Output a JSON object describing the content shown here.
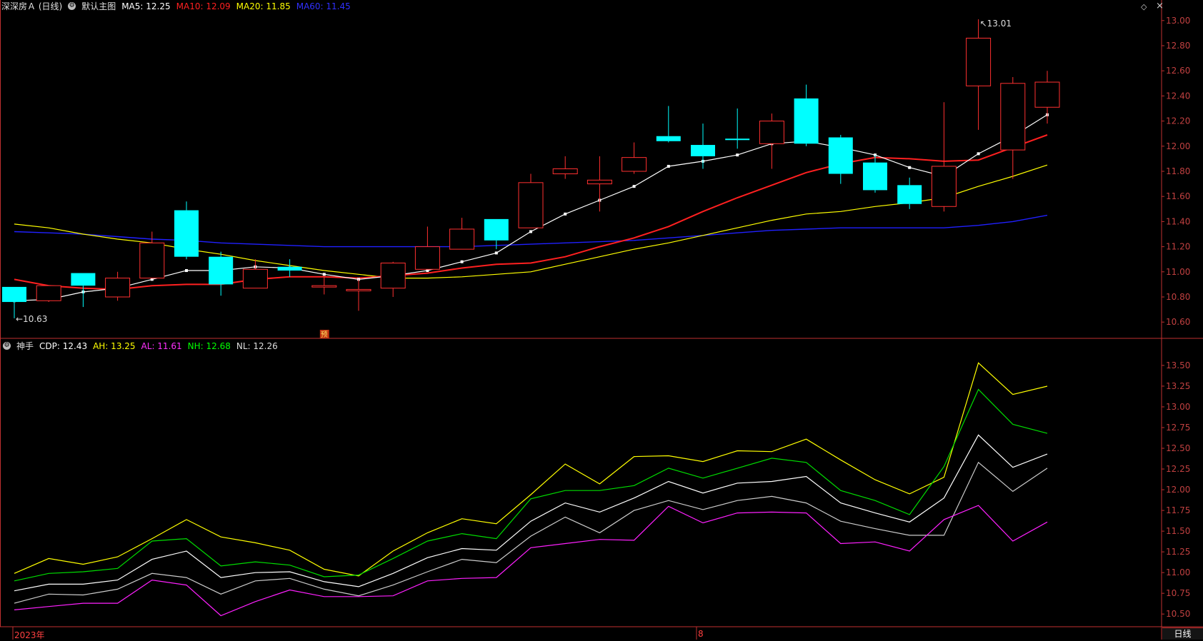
{
  "header": {
    "title": "深深房Ａ (日线)",
    "main_label": "默认主图",
    "ma_readouts": [
      {
        "label": "MA5: 12.25",
        "color": "#ffffff"
      },
      {
        "label": "MA10: 12.09",
        "color": "#ff2020"
      },
      {
        "label": "MA20: 11.85",
        "color": "#ffff00"
      },
      {
        "label": "MA60: 11.45",
        "color": "#3030ff"
      }
    ]
  },
  "indicator_header": {
    "name": "神手",
    "readouts": [
      {
        "label": "CDP: 12.43",
        "color": "#ffffff"
      },
      {
        "label": "AH: 13.25",
        "color": "#ffff00"
      },
      {
        "label": "AL: 11.61",
        "color": "#ff30ff"
      },
      {
        "label": "NH: 12.68",
        "color": "#00ff00"
      },
      {
        "label": "NL: 12.26",
        "color": "#dddddd"
      }
    ]
  },
  "footer": {
    "year_label": "2023年",
    "month_label": "8",
    "period_button": "日线"
  },
  "marker_label": "预",
  "colors": {
    "up": "#ff3030",
    "down": "#00ffff",
    "axis": "#c03030",
    "ma5": "#ffffff",
    "ma10": "#ff2020",
    "ma20": "#ffff00",
    "ma60": "#2020ff"
  },
  "chart_data": [
    {
      "type": "candlestick",
      "y_ticks": [
        10.6,
        10.8,
        11.0,
        11.2,
        11.4,
        11.6,
        11.8,
        12.0,
        12.2,
        12.4,
        12.6,
        12.8,
        13.0
      ],
      "ylim": [
        10.55,
        13.05
      ],
      "candles": [
        {
          "o": 10.88,
          "h": 10.88,
          "l": 10.63,
          "c": 10.76
        },
        {
          "o": 10.77,
          "h": 10.89,
          "l": 10.76,
          "c": 10.89
        },
        {
          "o": 10.99,
          "h": 10.99,
          "l": 10.72,
          "c": 10.89
        },
        {
          "o": 10.8,
          "h": 11.0,
          "l": 10.77,
          "c": 10.95
        },
        {
          "o": 10.95,
          "h": 11.32,
          "l": 10.95,
          "c": 11.23
        },
        {
          "o": 11.49,
          "h": 11.56,
          "l": 11.1,
          "c": 11.12
        },
        {
          "o": 11.12,
          "h": 11.16,
          "l": 10.81,
          "c": 10.9
        },
        {
          "o": 10.87,
          "h": 11.1,
          "l": 10.87,
          "c": 11.02
        },
        {
          "o": 11.04,
          "h": 11.1,
          "l": 10.96,
          "c": 11.01
        },
        {
          "o": 10.89,
          "h": 10.96,
          "l": 10.82,
          "c": 10.89
        },
        {
          "o": 10.85,
          "h": 10.94,
          "l": 10.69,
          "c": 10.86
        },
        {
          "o": 10.87,
          "h": 11.08,
          "l": 10.8,
          "c": 11.07
        },
        {
          "o": 11.02,
          "h": 11.36,
          "l": 11.02,
          "c": 11.2
        },
        {
          "o": 11.18,
          "h": 11.43,
          "l": 11.18,
          "c": 11.34
        },
        {
          "o": 11.42,
          "h": 11.42,
          "l": 11.18,
          "c": 11.25
        },
        {
          "o": 11.35,
          "h": 11.78,
          "l": 11.35,
          "c": 11.71
        },
        {
          "o": 11.78,
          "h": 11.92,
          "l": 11.74,
          "c": 11.82
        },
        {
          "o": 11.7,
          "h": 11.92,
          "l": 11.48,
          "c": 11.73
        },
        {
          "o": 11.8,
          "h": 12.03,
          "l": 11.78,
          "c": 11.91
        },
        {
          "o": 12.08,
          "h": 12.32,
          "l": 12.03,
          "c": 12.04
        },
        {
          "o": 12.01,
          "h": 12.18,
          "l": 11.82,
          "c": 11.92
        },
        {
          "o": 12.06,
          "h": 12.3,
          "l": 11.98,
          "c": 12.05
        },
        {
          "o": 12.02,
          "h": 12.26,
          "l": 11.82,
          "c": 12.2
        },
        {
          "o": 12.38,
          "h": 12.49,
          "l": 12.0,
          "c": 12.02
        },
        {
          "o": 12.07,
          "h": 12.09,
          "l": 11.7,
          "c": 11.78
        },
        {
          "o": 11.87,
          "h": 11.93,
          "l": 11.63,
          "c": 11.65
        },
        {
          "o": 11.69,
          "h": 11.75,
          "l": 11.5,
          "c": 11.54
        },
        {
          "o": 11.52,
          "h": 12.35,
          "l": 11.48,
          "c": 11.84
        },
        {
          "o": 12.48,
          "h": 13.01,
          "l": 12.13,
          "c": 12.86
        },
        {
          "o": 11.97,
          "h": 12.55,
          "l": 11.74,
          "c": 12.5
        },
        {
          "o": 12.31,
          "h": 12.6,
          "l": 12.18,
          "c": 12.51
        }
      ],
      "ma5": [
        10.77,
        10.78,
        10.84,
        10.87,
        10.94,
        11.01,
        11.01,
        11.04,
        11.03,
        10.98,
        10.94,
        10.97,
        11.01,
        11.08,
        11.15,
        11.32,
        11.46,
        11.57,
        11.68,
        11.84,
        11.88,
        11.93,
        12.02,
        12.04,
        11.99,
        11.93,
        11.83,
        11.76,
        11.94,
        12.08,
        12.25
      ],
      "ma10": [
        10.94,
        10.89,
        10.87,
        10.86,
        10.89,
        10.9,
        10.9,
        10.94,
        10.96,
        10.96,
        10.95,
        10.97,
        10.99,
        11.03,
        11.06,
        11.07,
        11.12,
        11.2,
        11.27,
        11.36,
        11.48,
        11.59,
        11.69,
        11.79,
        11.86,
        11.91,
        11.9,
        11.88,
        11.89,
        11.99,
        12.09
      ],
      "ma20": [
        11.38,
        11.35,
        11.3,
        11.26,
        11.23,
        11.18,
        11.14,
        11.09,
        11.05,
        11.01,
        10.98,
        10.95,
        10.95,
        10.96,
        10.98,
        11.0,
        11.06,
        11.12,
        11.18,
        11.23,
        11.29,
        11.35,
        11.41,
        11.46,
        11.48,
        11.52,
        11.55,
        11.59,
        11.68,
        11.76,
        11.85
      ],
      "ma60": [
        11.32,
        11.31,
        11.3,
        11.28,
        11.26,
        11.25,
        11.23,
        11.22,
        11.21,
        11.2,
        11.2,
        11.2,
        11.2,
        11.2,
        11.21,
        11.22,
        11.23,
        11.24,
        11.25,
        11.27,
        11.29,
        11.31,
        11.33,
        11.34,
        11.35,
        11.35,
        11.35,
        11.35,
        11.37,
        11.4,
        11.45
      ],
      "annotations": [
        {
          "text": "10.63"
        },
        {
          "text": "13.01"
        }
      ]
    },
    {
      "type": "line",
      "title": "神手",
      "y_ticks": [
        10.5,
        10.75,
        11.0,
        11.25,
        11.5,
        11.75,
        12.0,
        12.25,
        12.5,
        12.75,
        13.0,
        13.25,
        13.5
      ],
      "ylim": [
        10.45,
        13.62
      ],
      "series": [
        {
          "name": "AH",
          "values": [
            10.99,
            11.17,
            11.1,
            11.19,
            11.41,
            11.64,
            11.43,
            11.36,
            11.27,
            11.04,
            10.96,
            11.26,
            11.48,
            11.65,
            11.59,
            11.94,
            12.31,
            12.07,
            12.4,
            12.41,
            12.34,
            12.47,
            12.46,
            12.61,
            12.36,
            12.12,
            11.95,
            12.15,
            13.53,
            13.15,
            13.25
          ]
        },
        {
          "name": "NH",
          "values": [
            10.9,
            10.99,
            11.01,
            11.05,
            11.38,
            11.41,
            11.08,
            11.13,
            11.09,
            10.95,
            10.97,
            11.17,
            11.38,
            11.47,
            11.41,
            11.89,
            11.99,
            11.99,
            12.05,
            12.26,
            12.14,
            12.26,
            12.38,
            12.33,
            11.99,
            11.87,
            11.7,
            12.28,
            13.21,
            12.79,
            12.68
          ]
        },
        {
          "name": "CDP",
          "values": [
            10.78,
            10.86,
            10.86,
            10.91,
            11.16,
            11.26,
            10.94,
            11.0,
            11.01,
            10.89,
            10.83,
            10.99,
            11.18,
            11.29,
            11.27,
            11.62,
            11.84,
            11.73,
            11.9,
            12.1,
            11.96,
            12.08,
            12.1,
            12.16,
            11.84,
            11.72,
            11.61,
            11.9,
            12.66,
            12.27,
            12.43
          ]
        },
        {
          "name": "NL",
          "values": [
            10.63,
            10.74,
            10.73,
            10.8,
            10.99,
            10.94,
            10.74,
            10.9,
            10.93,
            10.8,
            10.72,
            10.85,
            11.01,
            11.16,
            11.12,
            11.44,
            11.67,
            11.48,
            11.75,
            11.87,
            11.76,
            11.87,
            11.92,
            11.84,
            11.62,
            11.53,
            11.45,
            11.45,
            12.33,
            11.98,
            12.26
          ]
        },
        {
          "name": "AL",
          "values": [
            10.55,
            10.59,
            10.63,
            10.63,
            10.91,
            10.85,
            10.48,
            10.65,
            10.79,
            10.71,
            10.71,
            10.72,
            10.9,
            10.93,
            10.94,
            11.3,
            11.35,
            11.4,
            11.39,
            11.8,
            11.6,
            11.72,
            11.73,
            11.72,
            11.35,
            11.37,
            11.26,
            11.64,
            11.81,
            11.38,
            11.61
          ]
        }
      ]
    }
  ]
}
